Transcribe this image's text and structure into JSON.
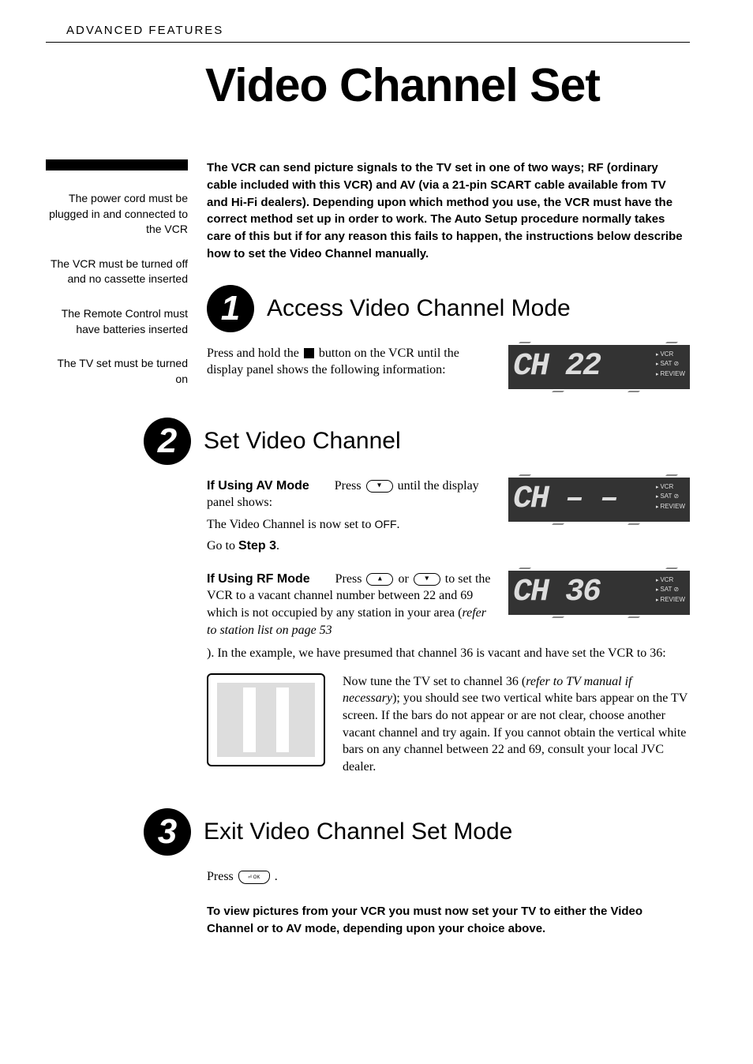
{
  "header": {
    "section": "ADVANCED FEATURES"
  },
  "title": "Video Channel Set",
  "sidebar": {
    "notes": [
      "The power cord must be plugged in and connected to the VCR",
      "The VCR must be turned off and no cassette inserted",
      "The Remote Control must have batteries inserted",
      "The TV set must be turned on"
    ]
  },
  "intro": "The VCR can send picture signals to the TV set in one of two ways; RF (ordinary cable included with this VCR) and AV (via a 21-pin SCART cable available from TV and Hi-Fi dealers). Depending upon which method you use, the VCR must have the correct method set up in order to work. The Auto Setup procedure normally takes care of this but if for any reason this fails to happen, the instructions below describe how to set the Video Channel manually.",
  "steps": {
    "s1": {
      "num": "1",
      "title": "Access Video Channel Mode",
      "body_pre": "Press and hold the ",
      "body_post": " button on the VCR until the display panel shows the following information:",
      "lcd": "CH 22"
    },
    "s2": {
      "num": "2",
      "title": "Set Video Channel",
      "av": {
        "label": "If Using AV Mode",
        "line1a": "Press ",
        "line1b": " until the display panel shows:",
        "line2a": "The Video Channel is now set to ",
        "line2_off": "OFF",
        "line2b": ".",
        "line3a": "Go to ",
        "line3_step": "Step 3",
        "line3b": ".",
        "lcd": "CH – –"
      },
      "rf": {
        "label": "If Using RF Mode",
        "line1a": "Press ",
        "line1b": " or ",
        "line1c": " to set the VCR to a vacant channel number between 22 and 69 which is not occupied by any station in your area (",
        "line1_ref": "refer to station list on page 53",
        "line1d": "). In the example, we have presumed that channel 36 is vacant and have set the VCR to 36:",
        "lcd": "CH 36",
        "tv_text_a": "Now tune the TV set to channel 36 (",
        "tv_text_ref": "refer to TV manual if necessary",
        "tv_text_b": "); you should see two vertical white bars appear on the TV screen. If the bars do not appear or are not clear, choose another vacant channel and try again. If you cannot obtain the vertical white bars on any channel between 22 and 69, consult your local JVC dealer."
      }
    },
    "s3": {
      "num": "3",
      "title": "Exit Video Channel Set Mode",
      "body_pre": "Press ",
      "body_post": " ."
    }
  },
  "final_note": "To view pictures from your VCR you must now set your TV to either the Video Channel or to AV mode, depending upon your choice above.",
  "lcd_labels": {
    "a": "VCR",
    "b": "SAT ⊘",
    "c": "REVIEW"
  }
}
